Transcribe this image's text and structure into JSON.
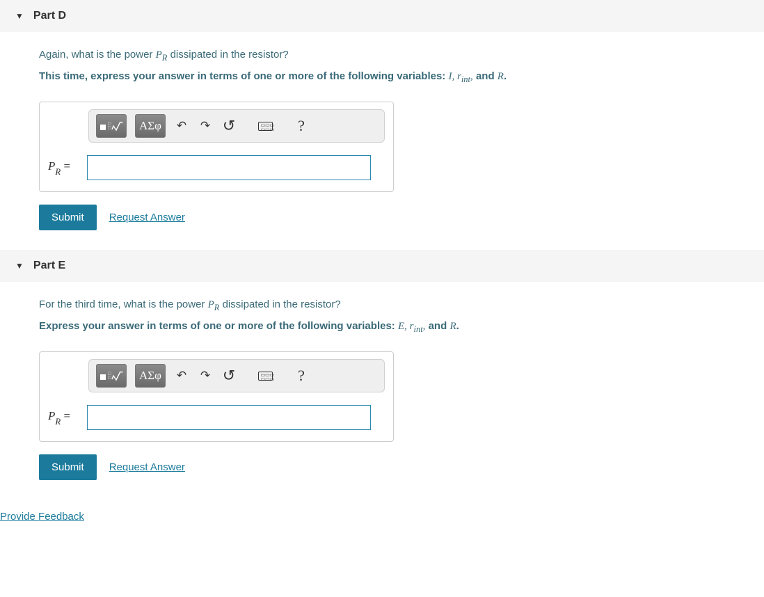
{
  "partD": {
    "title": "Part D",
    "question_pre": "Again, what is the power ",
    "question_var_html": "P<sub>R</sub>",
    "question_post": " dissipated in the resistor?",
    "hint_pre": "This time, express your answer in terms of one or more of the following variables: ",
    "hint_vars_html": "I,&nbsp;r<sub>int</sub>,",
    "hint_post": " and ",
    "hint_last_var": "R",
    "hint_end": ".",
    "answer_label": "P",
    "answer_sub": "R",
    "answer_eq": " = ",
    "submit": "Submit",
    "request": "Request Answer"
  },
  "partE": {
    "title": "Part E",
    "question_pre": "For the third time, what is the power ",
    "question_var_html": "P<sub>R</sub>",
    "question_post": " dissipated in the resistor?",
    "hint_pre": "Express your answer in terms of one or more of the following variables: ",
    "hint_vars_html": "&Epsilon;,&nbsp;r<sub>int</sub>,",
    "hint_post": " and ",
    "hint_last_var": "R",
    "hint_end": ".",
    "answer_label": "P",
    "answer_sub": "R",
    "answer_eq": " = ",
    "submit": "Submit",
    "request": "Request Answer"
  },
  "toolbar": {
    "templates": "■√□",
    "greek": "ΑΣφ",
    "undo": "↶",
    "redo": "↷",
    "reset": "↺",
    "keyboard": "⌨",
    "help": "?"
  },
  "feedback_link": "Provide Feedback"
}
